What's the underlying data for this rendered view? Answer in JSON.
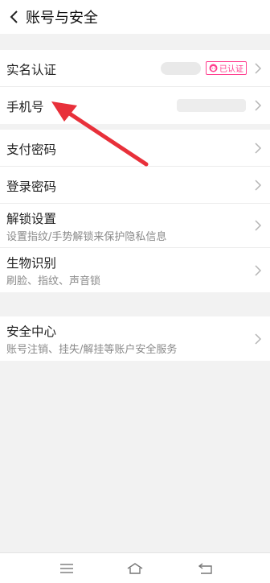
{
  "header": {
    "title": "账号与安全"
  },
  "groups": [
    {
      "items": [
        {
          "label": "实名认证",
          "badge": "已认证"
        },
        {
          "label": "手机号"
        }
      ]
    },
    {
      "items": [
        {
          "label": "支付密码"
        },
        {
          "label": "登录密码"
        },
        {
          "label": "解锁设置",
          "sub": "设置指纹/手势解锁来保护隐私信息"
        },
        {
          "label": "生物识别",
          "sub": "刷脸、指纹、声音锁"
        }
      ]
    },
    {
      "items": [
        {
          "label": "安全中心",
          "sub": "账号注销、挂失/解挂等账户安全服务"
        }
      ]
    }
  ],
  "icons": {
    "back": "chevron-left-icon",
    "chevron": "chevron-right-icon",
    "badge": "person-face-icon",
    "nav": [
      "menu-icon",
      "home-icon",
      "back-return-icon"
    ]
  },
  "colors": {
    "accent": "#ff3f8f",
    "annotation_arrow": "#e8303a",
    "background": "#f2f2f2"
  }
}
